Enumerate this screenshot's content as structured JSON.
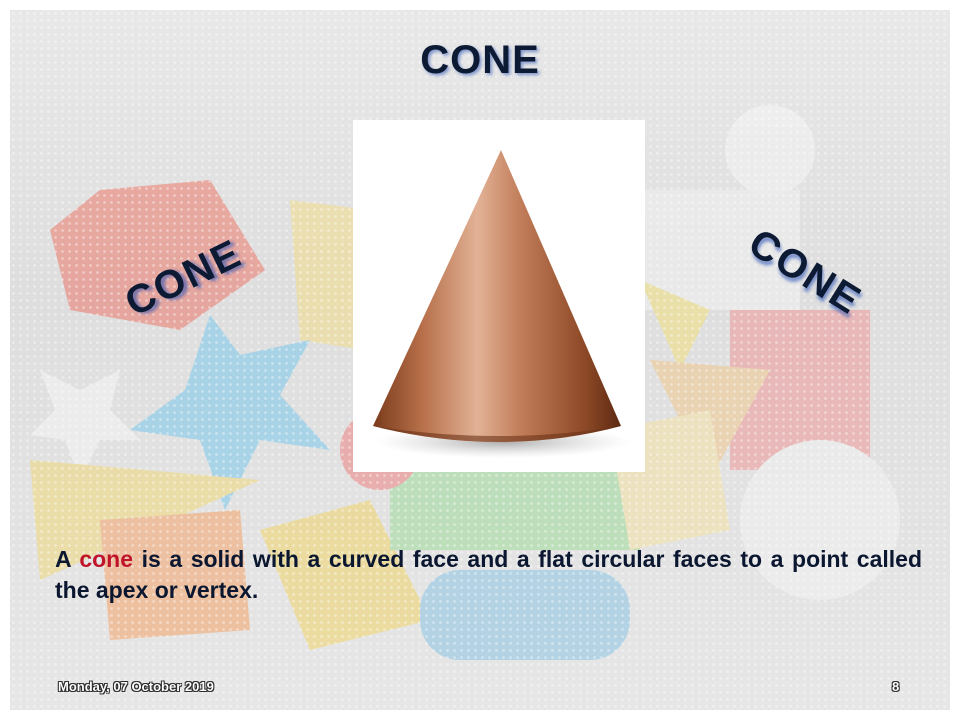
{
  "slide": {
    "title": "CONE",
    "left_label": "CONE",
    "right_label": "CONE",
    "body": {
      "prefix": "A ",
      "highlight": "cone",
      "suffix": " is a solid with a curved face and a flat circular faces  to a point called the apex or vertex."
    },
    "footer": {
      "date": "Monday, 07 October 2019",
      "page_number": "8"
    },
    "colors": {
      "title": "#0d1a33",
      "highlight": "#c0142a",
      "cone": "#b06a45"
    }
  }
}
